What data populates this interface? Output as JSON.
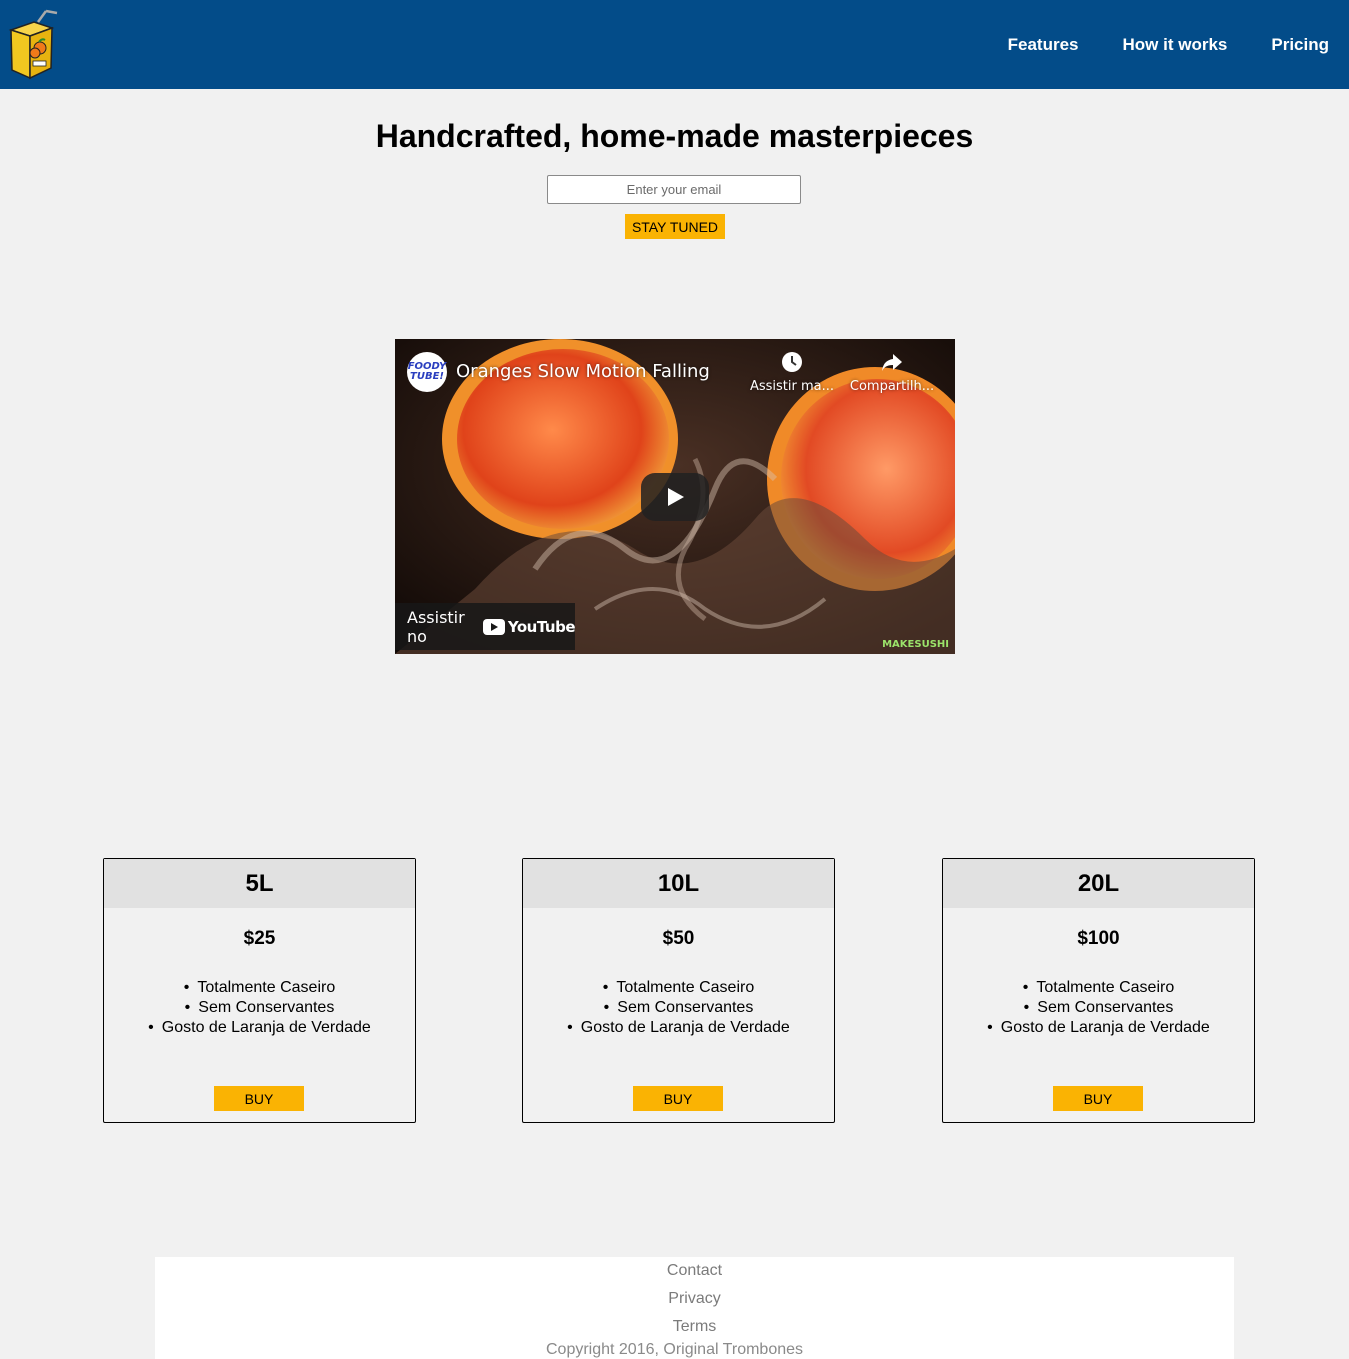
{
  "header": {
    "nav": [
      "Features",
      "How it works",
      "Pricing"
    ],
    "colors": {
      "background": "#034c89",
      "accent": "#fab303"
    }
  },
  "hero": {
    "title": "Handcrafted, home-made masterpieces",
    "email_placeholder": "Enter your email",
    "submit_label": "STAY TUNED"
  },
  "video": {
    "channel_avatar_text": "FOODY TUBE!",
    "title": "Oranges Slow Motion Falling",
    "watch_later_label": "Assistir ma...",
    "share_label": "Compartilh...",
    "watch_on_label": "Assistir no",
    "youtube_label": "YouTube",
    "watermark": "MAKESUSHI"
  },
  "pricing": [
    {
      "size": "5L",
      "price": "$25",
      "features": [
        "Totalmente Caseiro",
        "Sem Conservantes",
        "Gosto de Laranja de Verdade"
      ],
      "button": "BUY"
    },
    {
      "size": "10L",
      "price": "$50",
      "features": [
        "Totalmente Caseiro",
        "Sem Conservantes",
        "Gosto de Laranja de Verdade"
      ],
      "button": "BUY"
    },
    {
      "size": "20L",
      "price": "$100",
      "features": [
        "Totalmente Caseiro",
        "Sem Conservantes",
        "Gosto de Laranja de Verdade"
      ],
      "button": "BUY"
    }
  ],
  "footer": {
    "links": [
      "Contact",
      "Privacy",
      "Terms"
    ],
    "copyright": "Copyright 2016, Original Trombones"
  }
}
